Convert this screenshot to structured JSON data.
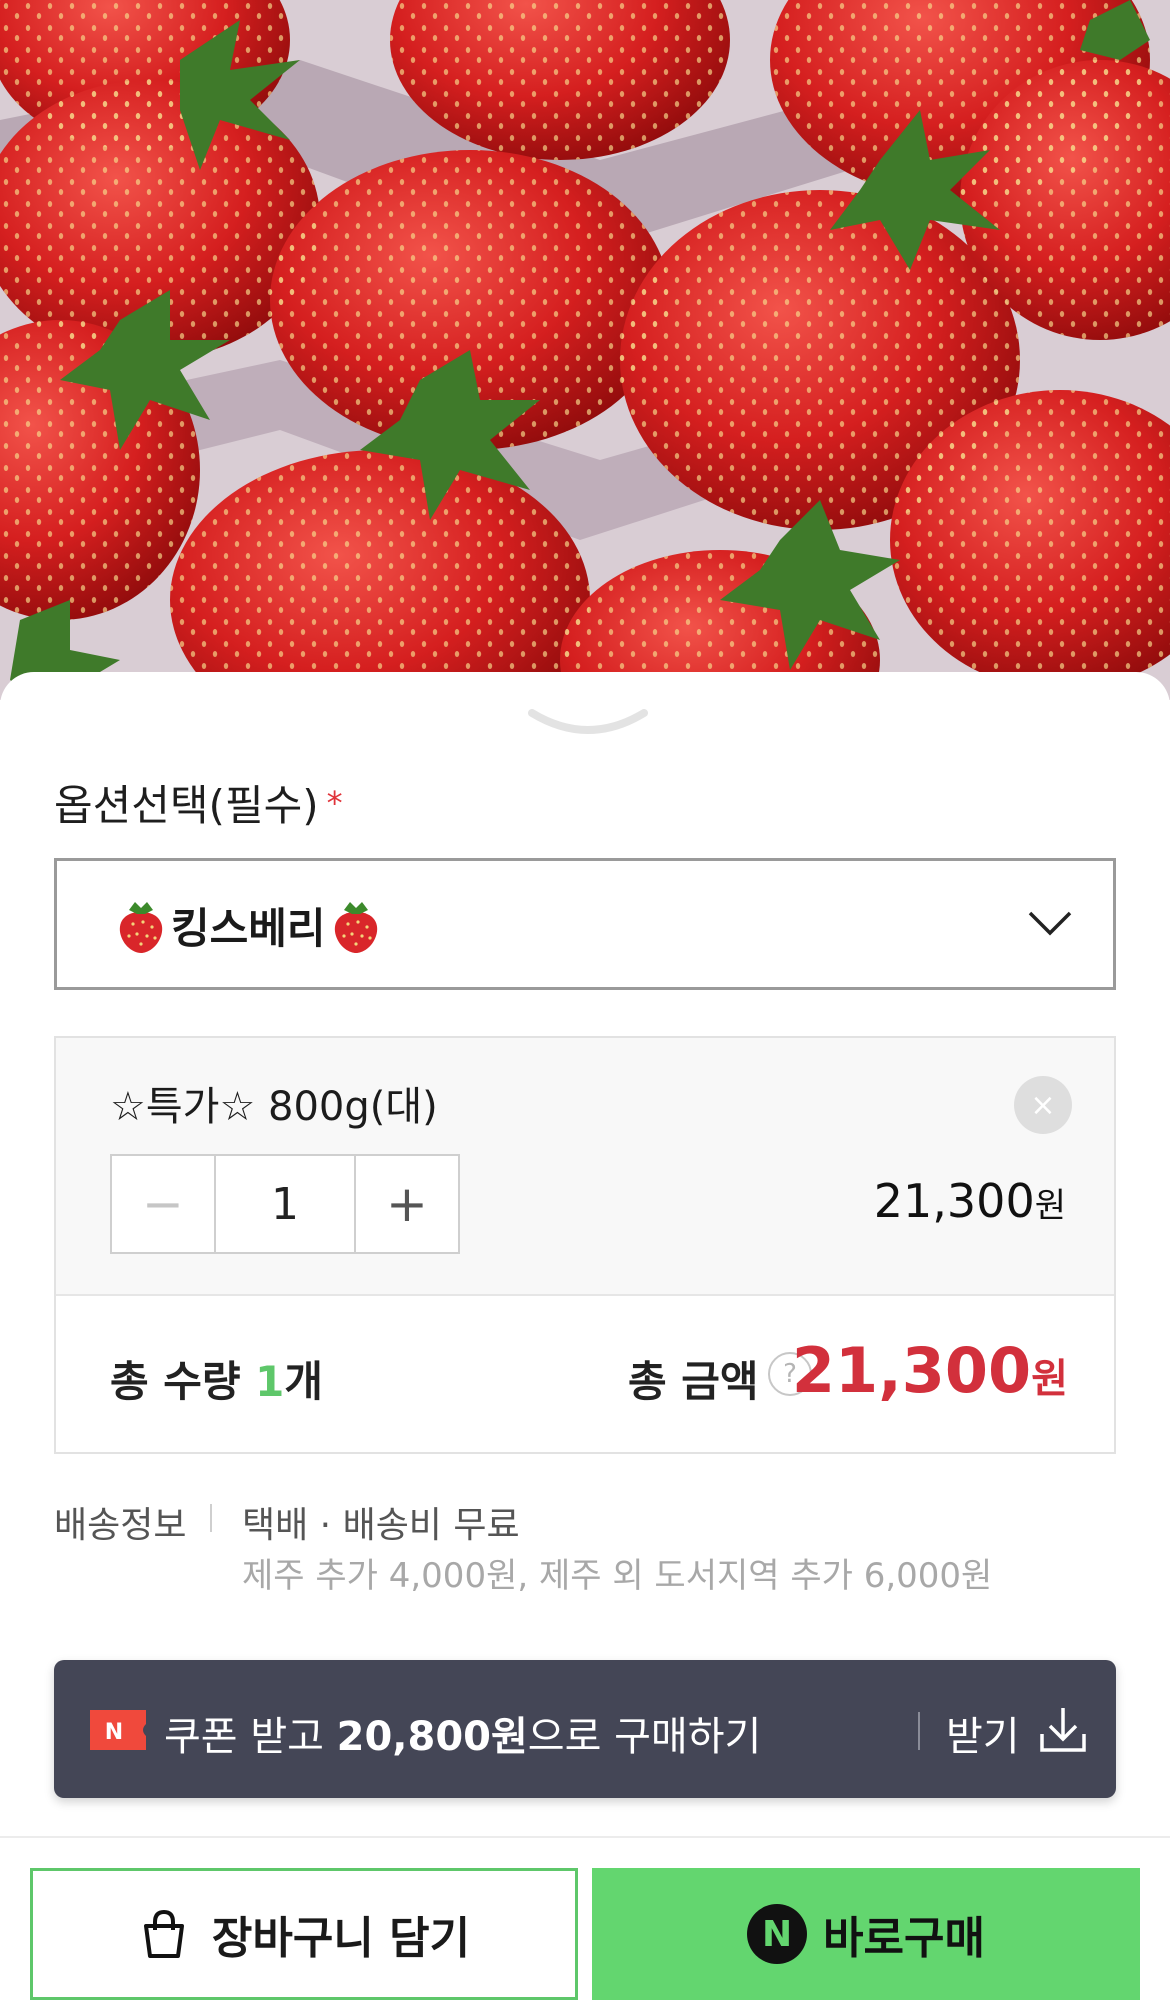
{
  "option": {
    "title": "옵션선택(필수)",
    "required_mark": "*",
    "selected": "킹스베리"
  },
  "item": {
    "name": "☆특가☆ 800g(대)",
    "quantity": "1",
    "minus": "−",
    "plus": "+",
    "price": "21,300",
    "price_unit": "원",
    "remove": "×"
  },
  "totals": {
    "qty_label": "총 수량",
    "qty_value": "1",
    "qty_unit": "개",
    "amount_label": "총 금액",
    "help": "?",
    "amount": "21,300",
    "amount_unit": "원"
  },
  "shipping": {
    "label": "배송정보",
    "main": "택배 · 배송비 무료",
    "sub": "제주 추가 4,000원, 제주 외 도서지역 추가 6,000원"
  },
  "coupon": {
    "text_pre": "쿠폰 받고 ",
    "amount": "20,800원",
    "text_post": "으로 구매하기",
    "action": "받기",
    "badge": "N"
  },
  "actions": {
    "cart": "장바구니 담기",
    "buy": "바로구매",
    "buy_logo": "N"
  },
  "colors": {
    "accent_green": "#63d66f",
    "price_red": "#d2303c",
    "coupon_bg": "#444656"
  }
}
